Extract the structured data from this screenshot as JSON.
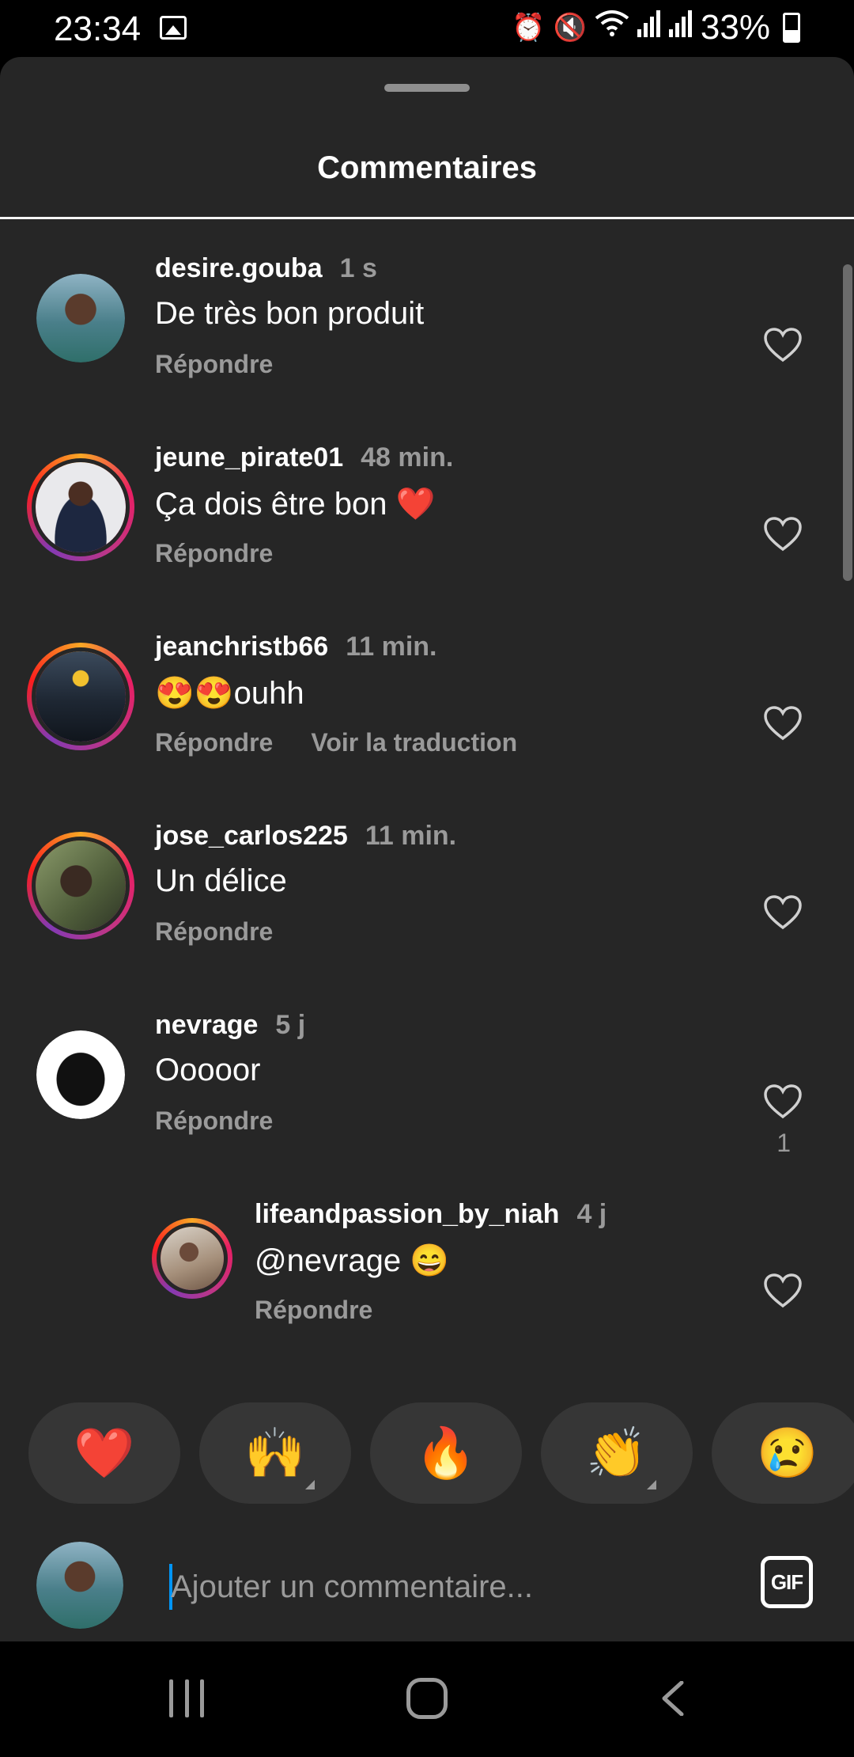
{
  "status_bar": {
    "time": "23:34",
    "battery": "33%",
    "icons": [
      "image-icon",
      "alarm-icon",
      "mute-icon",
      "wifi-icon",
      "signal-icon",
      "signal-icon",
      "battery-icon"
    ]
  },
  "sheet": {
    "title": "Commentaires"
  },
  "comments": [
    {
      "username": "desire.gouba",
      "time": "1 s",
      "text": "De très bon produit",
      "reply": "Répondre",
      "translate": "",
      "likes": "",
      "ring": false
    },
    {
      "username": "jeune_pirate01",
      "time": "48 min.",
      "text": "Ça dois être bon ❤️",
      "reply": "Répondre",
      "translate": "",
      "likes": "",
      "ring": true
    },
    {
      "username": "jeanchristb66",
      "time": "11 min.",
      "text": "😍😍ouhh",
      "reply": "Répondre",
      "translate": "Voir la traduction",
      "likes": "",
      "ring": true
    },
    {
      "username": "jose_carlos225",
      "time": "11 min.",
      "text": "Un délice",
      "reply": "Répondre",
      "translate": "",
      "likes": "",
      "ring": true
    },
    {
      "username": "nevrage",
      "time": "5 j",
      "text": "Ooooor",
      "reply": "Répondre",
      "translate": "",
      "likes": "1",
      "ring": false
    },
    {
      "username": "lifeandpassion_by_niah",
      "time": "4 j",
      "text": "@nevrage 😄",
      "reply": "Répondre",
      "translate": "",
      "likes": "",
      "ring": true
    }
  ],
  "reactions": [
    "❤️",
    "🙌",
    "🔥",
    "👏",
    "😢"
  ],
  "composer": {
    "placeholder": "Ajouter un commentaire...",
    "gif_label": "GIF"
  },
  "colors": {
    "sheet_bg": "#262626",
    "muted_text": "#9a9a9a",
    "caret": "#0095f6"
  }
}
